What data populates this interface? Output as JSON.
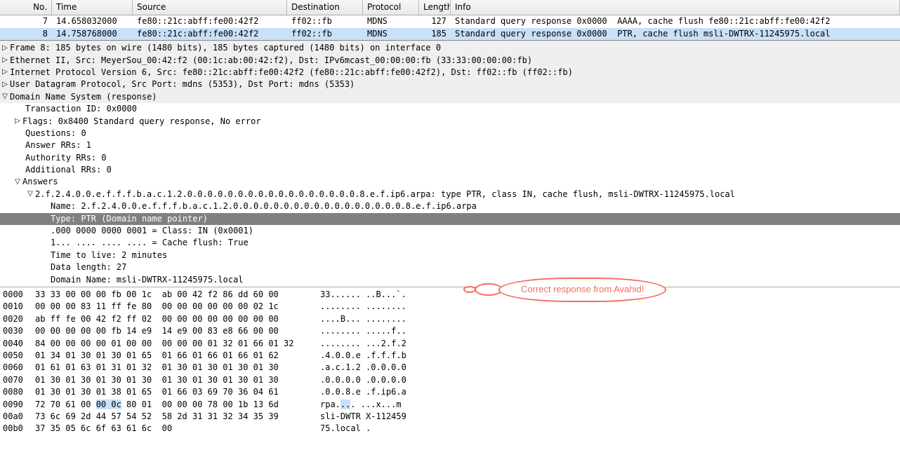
{
  "columns": {
    "no": "No.",
    "time": "Time",
    "source": "Source",
    "destination": "Destination",
    "protocol": "Protocol",
    "length": "Length",
    "info": "Info"
  },
  "packets": [
    {
      "no": "7",
      "time": "14.658032000",
      "src": "fe80::21c:abff:fe00:42f2",
      "dst": "ff02::fb",
      "proto": "MDNS",
      "len": "127",
      "info": "Standard query response 0x0000  AAAA, cache flush fe80::21c:abff:fe00:42f2"
    },
    {
      "no": "8",
      "time": "14.758768000",
      "src": "fe80::21c:abff:fe00:42f2",
      "dst": "ff02::fb",
      "proto": "MDNS",
      "len": "185",
      "info": "Standard query response 0x0000  PTR, cache flush msli-DWTRX-11245975.local"
    }
  ],
  "details": {
    "frame": "Frame 8: 185 bytes on wire (1480 bits), 185 bytes captured (1480 bits) on interface 0",
    "eth": "Ethernet II, Src: MeyerSou_00:42:f2 (00:1c:ab:00:42:f2), Dst: IPv6mcast_00:00:00:fb (33:33:00:00:00:fb)",
    "ipv6": "Internet Protocol Version 6, Src: fe80::21c:abff:fe00:42f2 (fe80::21c:abff:fe00:42f2), Dst: ff02::fb (ff02::fb)",
    "udp": "User Datagram Protocol, Src Port: mdns (5353), Dst Port: mdns (5353)",
    "dns": "Domain Name System (response)",
    "txid": "Transaction ID: 0x0000",
    "flags": "Flags: 0x8400 Standard query response, No error",
    "questions": "Questions: 0",
    "answerrrs": "Answer RRs: 1",
    "authrrs": "Authority RRs: 0",
    "addrrs": "Additional RRs: 0",
    "answers": "Answers",
    "answer0": "2.f.2.4.0.0.e.f.f.f.b.a.c.1.2.0.0.0.0.0.0.0.0.0.0.0.0.0.0.0.0.0.8.e.f.ip6.arpa: type PTR, class IN, cache flush, msli-DWTRX-11245975.local",
    "name": "Name: 2.f.2.4.0.0.e.f.f.f.b.a.c.1.2.0.0.0.0.0.0.0.0.0.0.0.0.0.0.0.0.0.8.e.f.ip6.arpa",
    "type": "Type: PTR (Domain name pointer)",
    "class": ".000 0000 0000 0001 = Class: IN (0x0001)",
    "cacheflush": "1... .... .... .... = Cache flush: True",
    "ttl": "Time to live: 2 minutes",
    "datalen": "Data length: 27",
    "domainname": "Domain Name: msli-DWTRX-11245975.local"
  },
  "hex": [
    {
      "off": "0000",
      "hx": "33 33 00 00 00 fb 00 1c  ab 00 42 f2 86 dd 60 00",
      "asc": "33...... ..B...`."
    },
    {
      "off": "0010",
      "hx": "00 00 00 83 11 ff fe 80  00 00 00 00 00 00 02 1c",
      "asc": "........ ........"
    },
    {
      "off": "0020",
      "hx": "ab ff fe 00 42 f2 ff 02  00 00 00 00 00 00 00 00",
      "asc": "....B... ........"
    },
    {
      "off": "0030",
      "hx": "00 00 00 00 00 fb 14 e9  14 e9 00 83 e8 66 00 00",
      "asc": "........ .....f.."
    },
    {
      "off": "0040",
      "hx": "84 00 00 00 00 01 00 00  00 00 00 01 32 01 66 01 32",
      "asc": "........ ...2.f.2"
    },
    {
      "off": "0050",
      "hx": "01 34 01 30 01 30 01 65  01 66 01 66 01 66 01 62",
      "asc": ".4.0.0.e .f.f.f.b"
    },
    {
      "off": "0060",
      "hx": "01 61 01 63 01 31 01 32  01 30 01 30 01 30 01 30",
      "asc": ".a.c.1.2 .0.0.0.0"
    },
    {
      "off": "0070",
      "hx": "01 30 01 30 01 30 01 30  01 30 01 30 01 30 01 30",
      "asc": ".0.0.0.0 .0.0.0.0"
    },
    {
      "off": "0080",
      "hx": "01 30 01 30 01 38 01 65  01 66 03 69 70 36 04 61",
      "asc": ".0.0.8.e .f.ip6.a"
    },
    {
      "off": "0090",
      "hx": "72 70 61 00 ",
      "hx2": "00 0c",
      "hx3": " 80 01  00 00 00 78 00 1b 13 6d",
      "asc": "rpa.",
      "asc2": "..",
      "asc3": ". ...x...m"
    },
    {
      "off": "00a0",
      "hx": "73 6c 69 2d 44 57 54 52  58 2d 31 31 32 34 35 39",
      "asc": "sli-DWTR X-112459"
    },
    {
      "off": "00b0",
      "hx": "37 35 05 6c 6f 63 61 6c  00",
      "asc": "75.local ."
    }
  ],
  "callout": "Correct response from Avahid!"
}
